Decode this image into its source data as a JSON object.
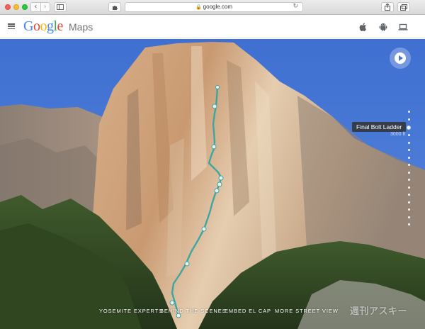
{
  "browser": {
    "url": "google.com",
    "back_glyph": "‹",
    "forward_glyph": "›",
    "reload_glyph": "↻",
    "icons": [
      "close-button",
      "minimize-button",
      "zoom-button",
      "back-icon",
      "forward-icon",
      "sidebar-icon",
      "extensions-icon",
      "lock-icon",
      "reload-icon",
      "share-icon",
      "tabs-icon"
    ]
  },
  "header": {
    "logo_letters": [
      "G",
      "o",
      "o",
      "g",
      "l",
      "e"
    ],
    "product": "Maps",
    "platform_icons": [
      "apple-icon",
      "android-icon",
      "laptop-icon"
    ]
  },
  "panorama": {
    "tooltip": "Final Bolt Ladder",
    "tooltip_sub": "3000 ft",
    "dot_count": 17,
    "active_dot_index": 3,
    "route_color": "#3ea6a0"
  },
  "bottom_links": [
    "YOSEMITE EXPERTS",
    "BEHIND THE SCENES",
    "EMBED EL CAP",
    "MORE STREET VIEW"
  ],
  "watermark": "週刊アスキー"
}
